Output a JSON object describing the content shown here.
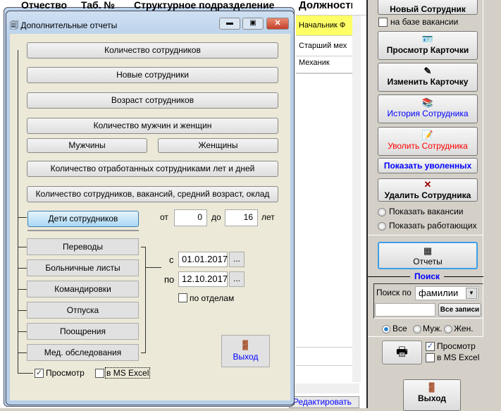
{
  "grid": {
    "headers": [
      "Отчество",
      "Таб. №",
      "Структурное подразделение",
      "Должность"
    ],
    "rows": [
      "Начальник Ф",
      "Старший мех",
      "Механик"
    ],
    "edit_label": "Редактировать"
  },
  "dialog": {
    "title": "Дополнительные отчеты",
    "buttons": [
      "Количество сотрудников",
      "Новые сотрудники",
      "Возраст сотрудников",
      "Количество мужчин и женщин"
    ],
    "men": "Мужчины",
    "women": "Женщины",
    "years_days": "Количество отработанных сотрудниками лет и дней",
    "vacancies": "Количество сотрудников, вакансий, средний возраст, оклад",
    "children": "Дети сотрудников",
    "from_label": "от",
    "from_value": "0",
    "to_label": "до",
    "to_value": "16",
    "years_label": "лет",
    "group_buttons": [
      "Переводы",
      "Больничные листы",
      "Командировки",
      "Отпуска",
      "Поощрения",
      "Мед. обследования"
    ],
    "date_from_label": "с",
    "date_from": "01.01.2017",
    "date_to_label": "по",
    "date_to": "12.10.2017",
    "ellipsis": "...",
    "by_dept": "по отделам",
    "exit": "Выход",
    "preview": "Просмотр",
    "excel": "в MS Excel"
  },
  "panel": {
    "new_employee": "Новый Сотрудник",
    "vacancy_base": "на базе вакансии",
    "view_card": "Просмотр Карточки",
    "edit_card": "Изменить Карточку",
    "history": "История Сотрудника",
    "dismiss": "Уволить Сотрудника",
    "show_dismissed": "Показать уволенных",
    "delete": "Удалить Сотрудника",
    "show_vacancies": "Показать вакансии",
    "show_working": "Показать работающих",
    "reports": "Отчеты",
    "search_title": "Поиск",
    "search_by": "Поиск по",
    "search_field": "фамилии",
    "all_records": "Все записи",
    "all": "Все",
    "male": "Муж.",
    "female": "Жен.",
    "preview": "Просмотр",
    "excel": "в MS Excel",
    "exit": "Выход"
  },
  "colors": {
    "blue": "#0000ff",
    "red": "#ff0000",
    "yellow": "#ffff66"
  }
}
